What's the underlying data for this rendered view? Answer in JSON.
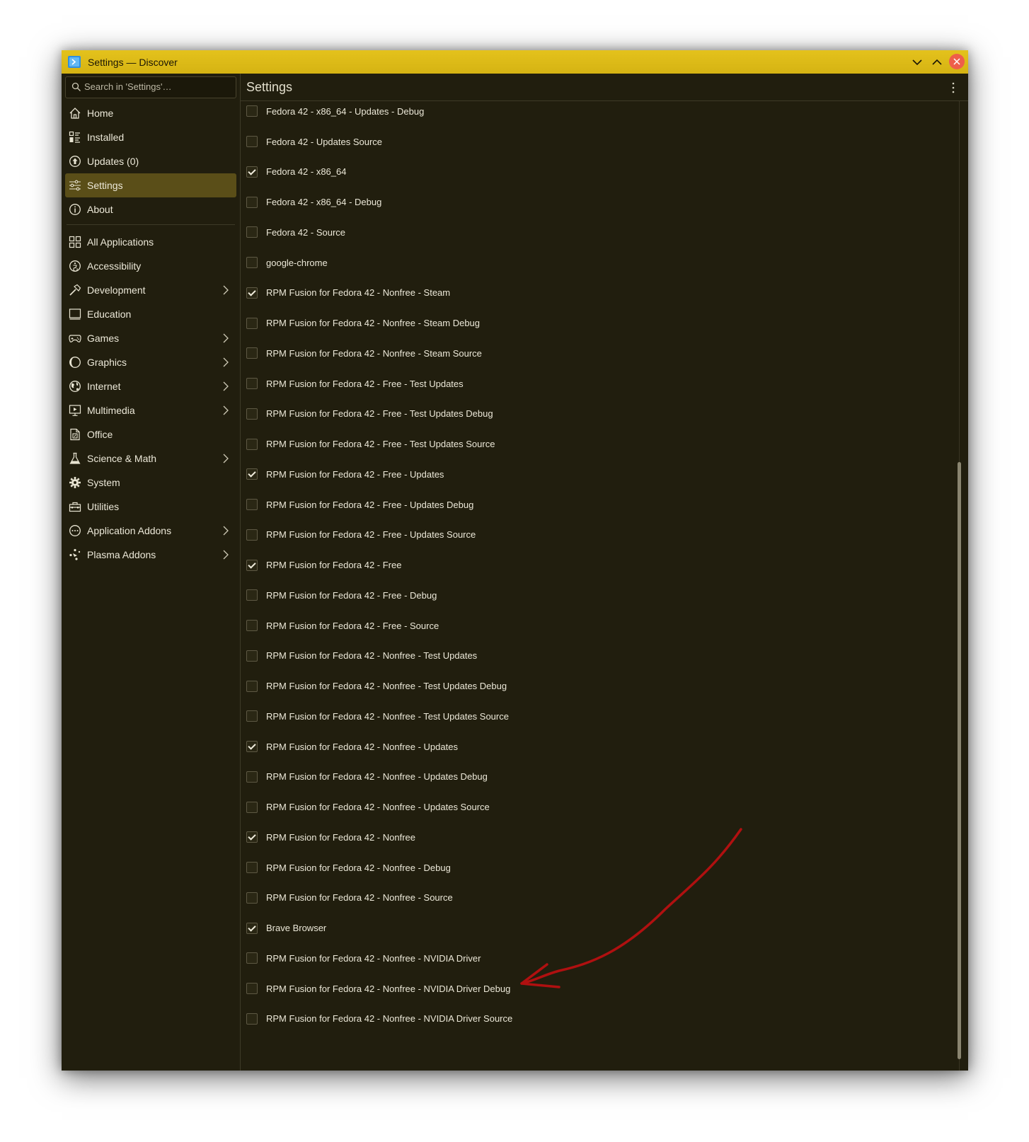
{
  "window": {
    "title": "Settings — Discover",
    "app_icon": "discover-icon",
    "controls": [
      "minimize-icon",
      "maximize-icon",
      "close-icon"
    ],
    "accent_color": "#dcbb18",
    "background_color": "#211e0e"
  },
  "sidebar": {
    "search_placeholder": "Search in 'Settings'…",
    "primary_items": [
      {
        "label": "Home",
        "icon": "home-icon",
        "active": false
      },
      {
        "label": "Installed",
        "icon": "installed-list-icon",
        "active": false
      },
      {
        "label": "Updates (0)",
        "icon": "updates-icon",
        "active": false
      },
      {
        "label": "Settings",
        "icon": "settings-sliders-icon",
        "active": true
      },
      {
        "label": "About",
        "icon": "info-icon",
        "active": false
      }
    ],
    "categories": [
      {
        "label": "All Applications",
        "icon": "grid-icon",
        "has_submenu": false
      },
      {
        "label": "Accessibility",
        "icon": "accessibility-icon",
        "has_submenu": false
      },
      {
        "label": "Development",
        "icon": "hammer-icon",
        "has_submenu": true
      },
      {
        "label": "Education",
        "icon": "education-icon",
        "has_submenu": false
      },
      {
        "label": "Games",
        "icon": "gamepad-icon",
        "has_submenu": true
      },
      {
        "label": "Graphics",
        "icon": "graphics-icon",
        "has_submenu": true
      },
      {
        "label": "Internet",
        "icon": "globe-icon",
        "has_submenu": true
      },
      {
        "label": "Multimedia",
        "icon": "multimedia-icon",
        "has_submenu": true
      },
      {
        "label": "Office",
        "icon": "office-icon",
        "has_submenu": false
      },
      {
        "label": "Science & Math",
        "icon": "flask-icon",
        "has_submenu": true
      },
      {
        "label": "System",
        "icon": "gear-icon",
        "has_submenu": false
      },
      {
        "label": "Utilities",
        "icon": "toolbox-icon",
        "has_submenu": false
      },
      {
        "label": "Application Addons",
        "icon": "addons-icon",
        "has_submenu": true
      },
      {
        "label": "Plasma Addons",
        "icon": "plasma-icon",
        "has_submenu": true
      }
    ]
  },
  "header": {
    "title": "Settings",
    "menu_icon": "kebab-menu-icon"
  },
  "repositories": [
    {
      "label": "Fedora 42 - x86_64 - Updates - Debug",
      "checked": false
    },
    {
      "label": "Fedora 42 - Updates Source",
      "checked": false
    },
    {
      "label": "Fedora 42 - x86_64",
      "checked": true
    },
    {
      "label": "Fedora 42 - x86_64 - Debug",
      "checked": false
    },
    {
      "label": "Fedora 42 - Source",
      "checked": false
    },
    {
      "label": "google-chrome",
      "checked": false
    },
    {
      "label": "RPM Fusion for Fedora 42 - Nonfree - Steam",
      "checked": true
    },
    {
      "label": "RPM Fusion for Fedora 42 - Nonfree - Steam Debug",
      "checked": false
    },
    {
      "label": "RPM Fusion for Fedora 42 - Nonfree - Steam Source",
      "checked": false
    },
    {
      "label": "RPM Fusion for Fedora 42 - Free - Test Updates",
      "checked": false
    },
    {
      "label": "RPM Fusion for Fedora 42 - Free - Test Updates Debug",
      "checked": false
    },
    {
      "label": "RPM Fusion for Fedora 42 - Free - Test Updates Source",
      "checked": false
    },
    {
      "label": "RPM Fusion for Fedora 42 - Free - Updates",
      "checked": true
    },
    {
      "label": "RPM Fusion for Fedora 42 - Free - Updates Debug",
      "checked": false
    },
    {
      "label": "RPM Fusion for Fedora 42 - Free - Updates Source",
      "checked": false
    },
    {
      "label": "RPM Fusion for Fedora 42 - Free",
      "checked": true
    },
    {
      "label": "RPM Fusion for Fedora 42 - Free - Debug",
      "checked": false
    },
    {
      "label": "RPM Fusion for Fedora 42 - Free - Source",
      "checked": false
    },
    {
      "label": "RPM Fusion for Fedora 42 - Nonfree - Test Updates",
      "checked": false
    },
    {
      "label": "RPM Fusion for Fedora 42 - Nonfree - Test Updates Debug",
      "checked": false
    },
    {
      "label": "RPM Fusion for Fedora 42 - Nonfree - Test Updates Source",
      "checked": false
    },
    {
      "label": "RPM Fusion for Fedora 42 - Nonfree - Updates",
      "checked": true
    },
    {
      "label": "RPM Fusion for Fedora 42 - Nonfree - Updates Debug",
      "checked": false
    },
    {
      "label": "RPM Fusion for Fedora 42 - Nonfree - Updates Source",
      "checked": false
    },
    {
      "label": "RPM Fusion for Fedora 42 - Nonfree",
      "checked": true
    },
    {
      "label": "RPM Fusion for Fedora 42 - Nonfree - Debug",
      "checked": false
    },
    {
      "label": "RPM Fusion for Fedora 42 - Nonfree - Source",
      "checked": false
    },
    {
      "label": "Brave Browser",
      "checked": true
    },
    {
      "label": "RPM Fusion for Fedora 42 - Nonfree - NVIDIA Driver",
      "checked": false
    },
    {
      "label": "RPM Fusion for Fedora 42 - Nonfree - NVIDIA Driver Debug",
      "checked": false
    },
    {
      "label": "RPM Fusion for Fedora 42 - Nonfree - NVIDIA Driver Source",
      "checked": false
    }
  ],
  "annotation": {
    "type": "hand-drawn-arrow",
    "color": "#b01010",
    "points_to": "RPM Fusion for Fedora 42 - Nonfree - NVIDIA Driver"
  }
}
